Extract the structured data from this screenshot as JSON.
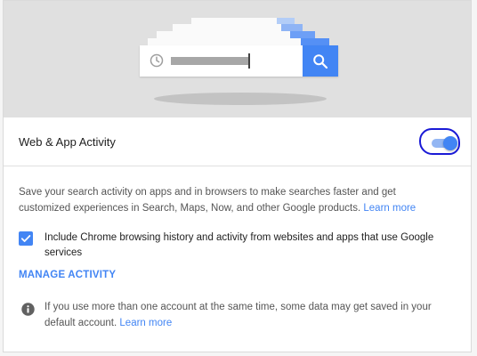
{
  "setting": {
    "title": "Web & App Activity",
    "enabled": true
  },
  "hero": {
    "icons": [
      "clock-icon",
      "search-icon"
    ]
  },
  "description": {
    "text": "Save your search activity on apps and in browsers to make searches faster and get customized experiences in Search, Maps, Now, and other Google products.",
    "learn_more": "Learn more"
  },
  "chrome_history": {
    "checked": true,
    "label": "Include Chrome browsing history and activity from websites and apps that use Google services"
  },
  "manage_activity": "MANAGE ACTIVITY",
  "info": {
    "icon": "info-icon",
    "text": "If you use more than one account at the same time, some data may get saved in your default account.",
    "learn_more": "Learn more"
  },
  "colors": {
    "accent": "#4285f4",
    "annotation_circle": "#1a1ad6",
    "hero_background": "#e0e0e0"
  }
}
